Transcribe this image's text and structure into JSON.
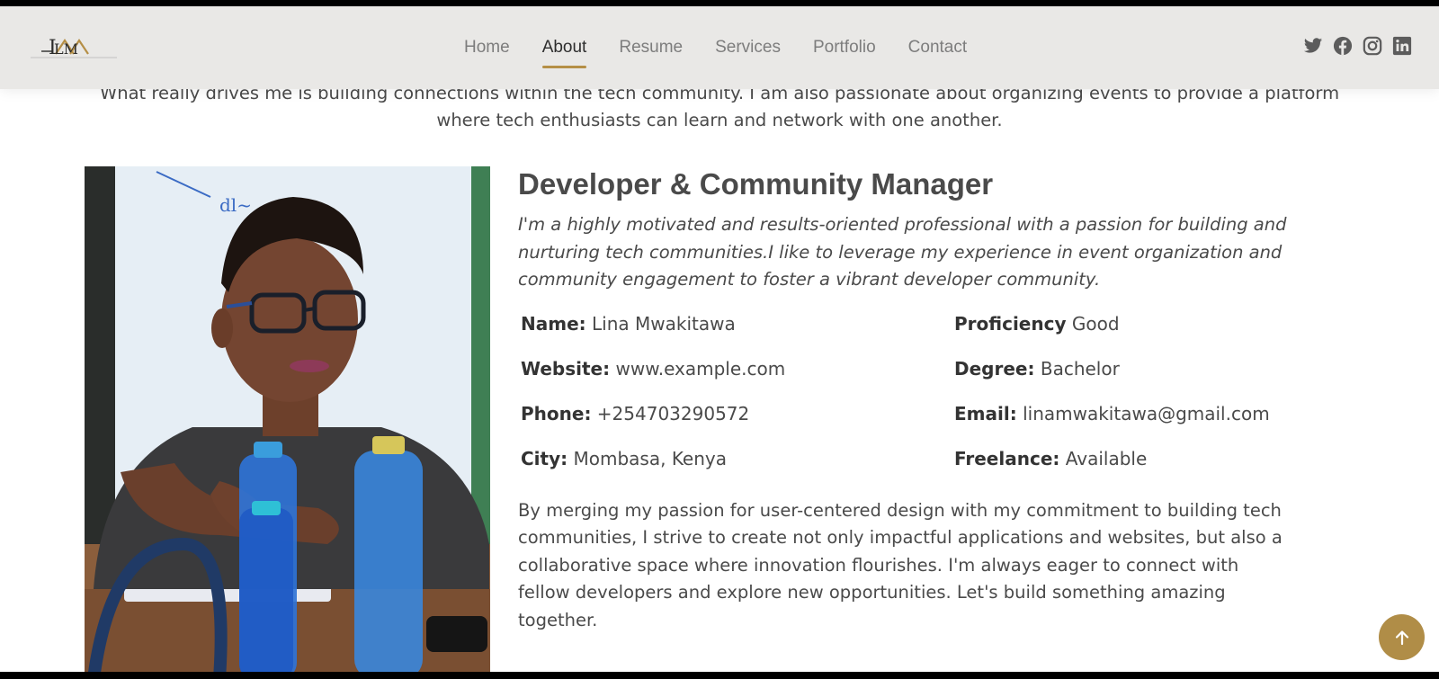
{
  "header": {
    "logo_text": "LM",
    "nav": [
      {
        "label": "Home",
        "active": false
      },
      {
        "label": "About",
        "active": true
      },
      {
        "label": "Resume",
        "active": false
      },
      {
        "label": "Services",
        "active": false
      },
      {
        "label": "Portfolio",
        "active": false
      },
      {
        "label": "Contact",
        "active": false
      }
    ],
    "social_icons": [
      "twitter-icon",
      "facebook-icon",
      "instagram-icon",
      "linkedin-icon"
    ]
  },
  "intro": "What really drives me is building connections within the tech community. I am also passionate about organizing events to provide a platform where tech enthusiasts can learn and network with one another.",
  "about": {
    "title": "Developer & Community Manager",
    "tagline": "I'm a highly motivated and results-oriented professional with a passion for building and nurturing tech communities.I like to leverage my experience in event organization and community engagement to foster a vibrant developer community.",
    "info": {
      "name_label": "Name:",
      "name_value": "Lina Mwakitawa",
      "proficiency_label": "Proficiency",
      "proficiency_value": "Good",
      "website_label": "Website:",
      "website_value": "www.example.com",
      "degree_label": "Degree:",
      "degree_value": "Bachelor",
      "phone_label": "Phone:",
      "phone_value": "+254703290572",
      "email_label": "Email:",
      "email_value": "linamwakitawa@gmail.com",
      "city_label": "City:",
      "city_value": "Mombasa, Kenya",
      "freelance_label": "Freelance:",
      "freelance_value": "Available"
    },
    "summary": "By merging my passion for user-centered design with my commitment to building tech communities, I strive to create not only impactful applications and websites, but also a collaborative space where innovation flourishes. I'm always eager to connect with fellow developers and explore new opportunities. Let's build something amazing together."
  },
  "colors": {
    "accent": "#b08d47",
    "header_bg": "#e9e8e6",
    "text": "#4a4a4a"
  },
  "back_to_top_icon": "arrow-up-icon"
}
